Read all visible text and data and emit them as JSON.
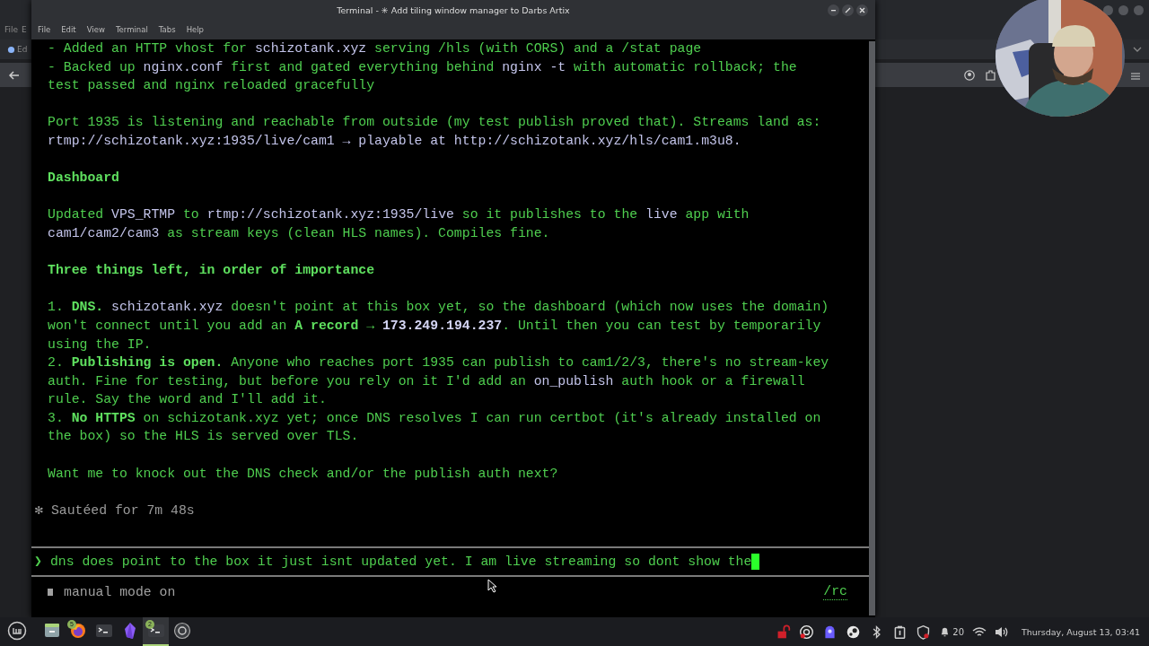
{
  "background_window": {
    "menu": [
      "File",
      "E"
    ],
    "tab": "Ed"
  },
  "window": {
    "title": "Terminal - ✳ Add tiling window manager to Darbs Artix"
  },
  "menu": [
    "File",
    "Edit",
    "View",
    "Terminal",
    "Tabs",
    "Help"
  ],
  "output": [
    {
      "lines": [
        {
          "segments": [
            {
              "text": "- Added an HTTP vhost for ",
              "kind": "plain"
            },
            {
              "text": "schizotank.xyz",
              "kind": "code"
            },
            {
              "text": " serving /hls (with CORS) and a /stat page",
              "kind": "plain"
            }
          ]
        },
        {
          "segments": [
            {
              "text": "- Backed up ",
              "kind": "plain"
            },
            {
              "text": "nginx.conf",
              "kind": "code"
            },
            {
              "text": " first and gated everything behind ",
              "kind": "plain"
            },
            {
              "text": "nginx -t",
              "kind": "code"
            },
            {
              "text": " with automatic rollback; the",
              "kind": "plain"
            }
          ]
        },
        {
          "segments": [
            {
              "text": "test passed and nginx reloaded gracefully",
              "kind": "plain"
            }
          ]
        }
      ]
    },
    {
      "lines": [
        {
          "segments": [
            {
              "text": "Port 1935 is listening and reachable from outside (my test publish proved that). Streams land as:",
              "kind": "plain"
            }
          ]
        },
        {
          "segments": [
            {
              "text": "rtmp://schizotank.xyz:1935/live/cam1 → playable at http://schizotank.xyz/hls/cam1.m3u8.",
              "kind": "code"
            }
          ]
        }
      ]
    },
    {
      "lines": [
        {
          "segments": [
            {
              "text": "Dashboard",
              "kind": "bold"
            }
          ]
        }
      ]
    },
    {
      "lines": [
        {
          "segments": [
            {
              "text": "Updated ",
              "kind": "plain"
            },
            {
              "text": "VPS_RTMP",
              "kind": "code"
            },
            {
              "text": " to ",
              "kind": "plain"
            },
            {
              "text": "rtmp://schizotank.xyz:1935/live",
              "kind": "code"
            },
            {
              "text": " so it publishes to the ",
              "kind": "plain"
            },
            {
              "text": "live",
              "kind": "code"
            },
            {
              "text": " app with",
              "kind": "plain"
            }
          ]
        },
        {
          "segments": [
            {
              "text": "cam1/cam2/cam3",
              "kind": "code"
            },
            {
              "text": " as stream keys (clean HLS names). Compiles fine.",
              "kind": "plain"
            }
          ]
        }
      ]
    },
    {
      "lines": [
        {
          "segments": [
            {
              "text": "Three things left, in order of importance",
              "kind": "bold"
            }
          ]
        }
      ]
    },
    {
      "lines": [
        {
          "segments": [
            {
              "text": "1. ",
              "kind": "plain"
            },
            {
              "text": "DNS.",
              "kind": "bold"
            },
            {
              "text": " schizotank.xyz",
              "kind": "code"
            },
            {
              "text": " doesn't point at this box yet, so the dashboard (which now uses the domain)",
              "kind": "plain"
            }
          ]
        },
        {
          "segments": [
            {
              "text": "won't connect until you add an ",
              "kind": "plain"
            },
            {
              "text": "A record",
              "kind": "bold"
            },
            {
              "text": " → ",
              "kind": "plain"
            },
            {
              "text": "173.249.194.237",
              "kind": "code_bold"
            },
            {
              "text": ". Until then you can test by temporarily",
              "kind": "plain"
            }
          ]
        },
        {
          "segments": [
            {
              "text": "using the IP.",
              "kind": "plain"
            }
          ]
        },
        {
          "segments": [
            {
              "text": "2. ",
              "kind": "plain"
            },
            {
              "text": "Publishing is open.",
              "kind": "bold"
            },
            {
              "text": " Anyone who reaches port 1935 can publish to cam1/2/3, there's no stream-key",
              "kind": "plain"
            }
          ]
        },
        {
          "segments": [
            {
              "text": "auth. Fine for testing, but before you rely on it I'd add an ",
              "kind": "plain"
            },
            {
              "text": "on_publish",
              "kind": "code"
            },
            {
              "text": " auth hook or a firewall",
              "kind": "plain"
            }
          ]
        },
        {
          "segments": [
            {
              "text": "rule. Say the word and I'll add it.",
              "kind": "plain"
            }
          ]
        },
        {
          "segments": [
            {
              "text": "3. ",
              "kind": "plain"
            },
            {
              "text": "No HTTPS",
              "kind": "bold"
            },
            {
              "text": " on schizotank.xyz yet; once DNS resolves I can run certbot (it's already installed on",
              "kind": "plain"
            }
          ]
        },
        {
          "segments": [
            {
              "text": "the box) so the HLS is served over TLS.",
              "kind": "plain"
            }
          ]
        }
      ]
    },
    {
      "lines": [
        {
          "segments": [
            {
              "text": "Want me to knock out the DNS check and/or the publish auth next?",
              "kind": "plain"
            }
          ]
        }
      ]
    }
  ],
  "status": {
    "icon": "✻",
    "text": "Sautéed for 7m 48s"
  },
  "prompt": {
    "symbol": "❯",
    "value": "dns does point to the box it just isnt updated yet. I am live streaming so dont show the"
  },
  "mode": {
    "text": "manual mode on",
    "command": "/rc"
  },
  "taskbar": {
    "apps": [
      {
        "selected": false
      },
      {
        "selected": false,
        "badge": "5"
      },
      {
        "selected": false
      },
      {
        "selected": false
      },
      {
        "selected": true,
        "badge": "2"
      },
      {
        "selected": false
      }
    ],
    "notification_count": "20",
    "clock": "Thursday, August 13, 03:41"
  }
}
